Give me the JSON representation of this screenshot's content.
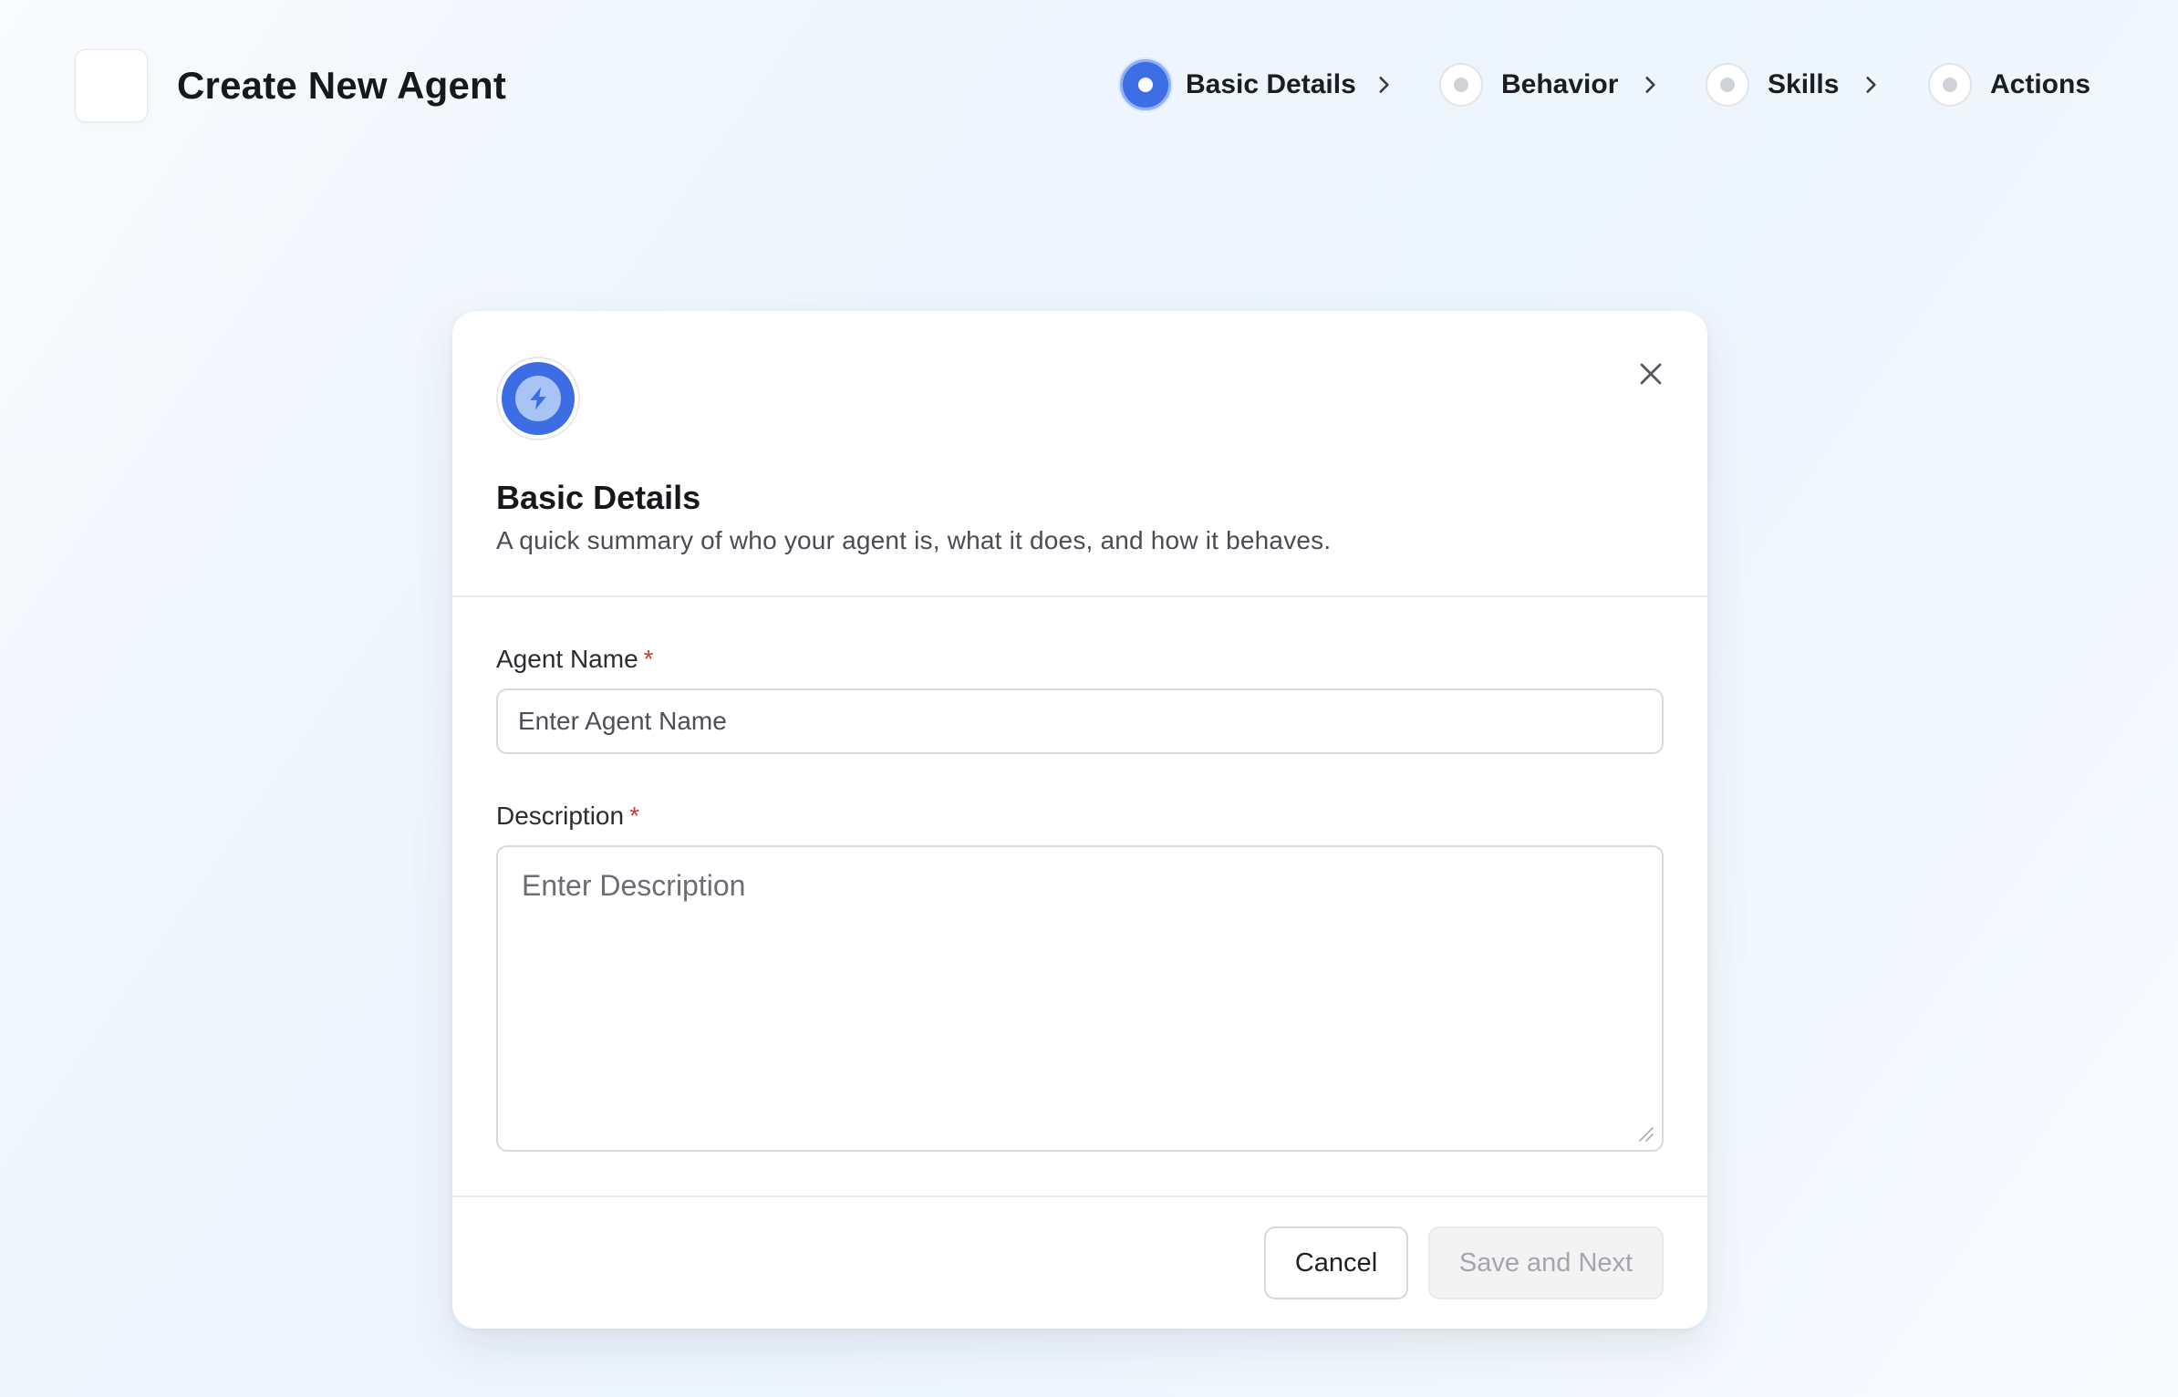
{
  "header": {
    "title": "Create New Agent",
    "logo_icon": "app-logo-placeholder"
  },
  "stepper": {
    "steps": [
      {
        "label": "Basic Details",
        "state": "active"
      },
      {
        "label": "Behavior",
        "state": "pending"
      },
      {
        "label": "Skills",
        "state": "pending"
      },
      {
        "label": "Actions",
        "state": "pending"
      }
    ],
    "separator_icon": "chevron-right-icon"
  },
  "modal": {
    "icon": "lightning-bolt-icon",
    "close_icon": "close-icon",
    "title": "Basic Details",
    "subtitle": "A quick summary of who your agent is, what it does, and how it behaves.",
    "fields": {
      "agent_name": {
        "label": "Agent Name",
        "required_mark": "*",
        "placeholder": "Enter Agent Name",
        "value": ""
      },
      "description": {
        "label": "Description",
        "required_mark": "*",
        "placeholder": "Enter Description",
        "value": ""
      }
    },
    "buttons": {
      "cancel": "Cancel",
      "save_next": "Save and Next"
    }
  },
  "colors": {
    "accent": "#3d6ee6",
    "required": "#d23a2e",
    "disabled_text": "#a3a6ac"
  }
}
